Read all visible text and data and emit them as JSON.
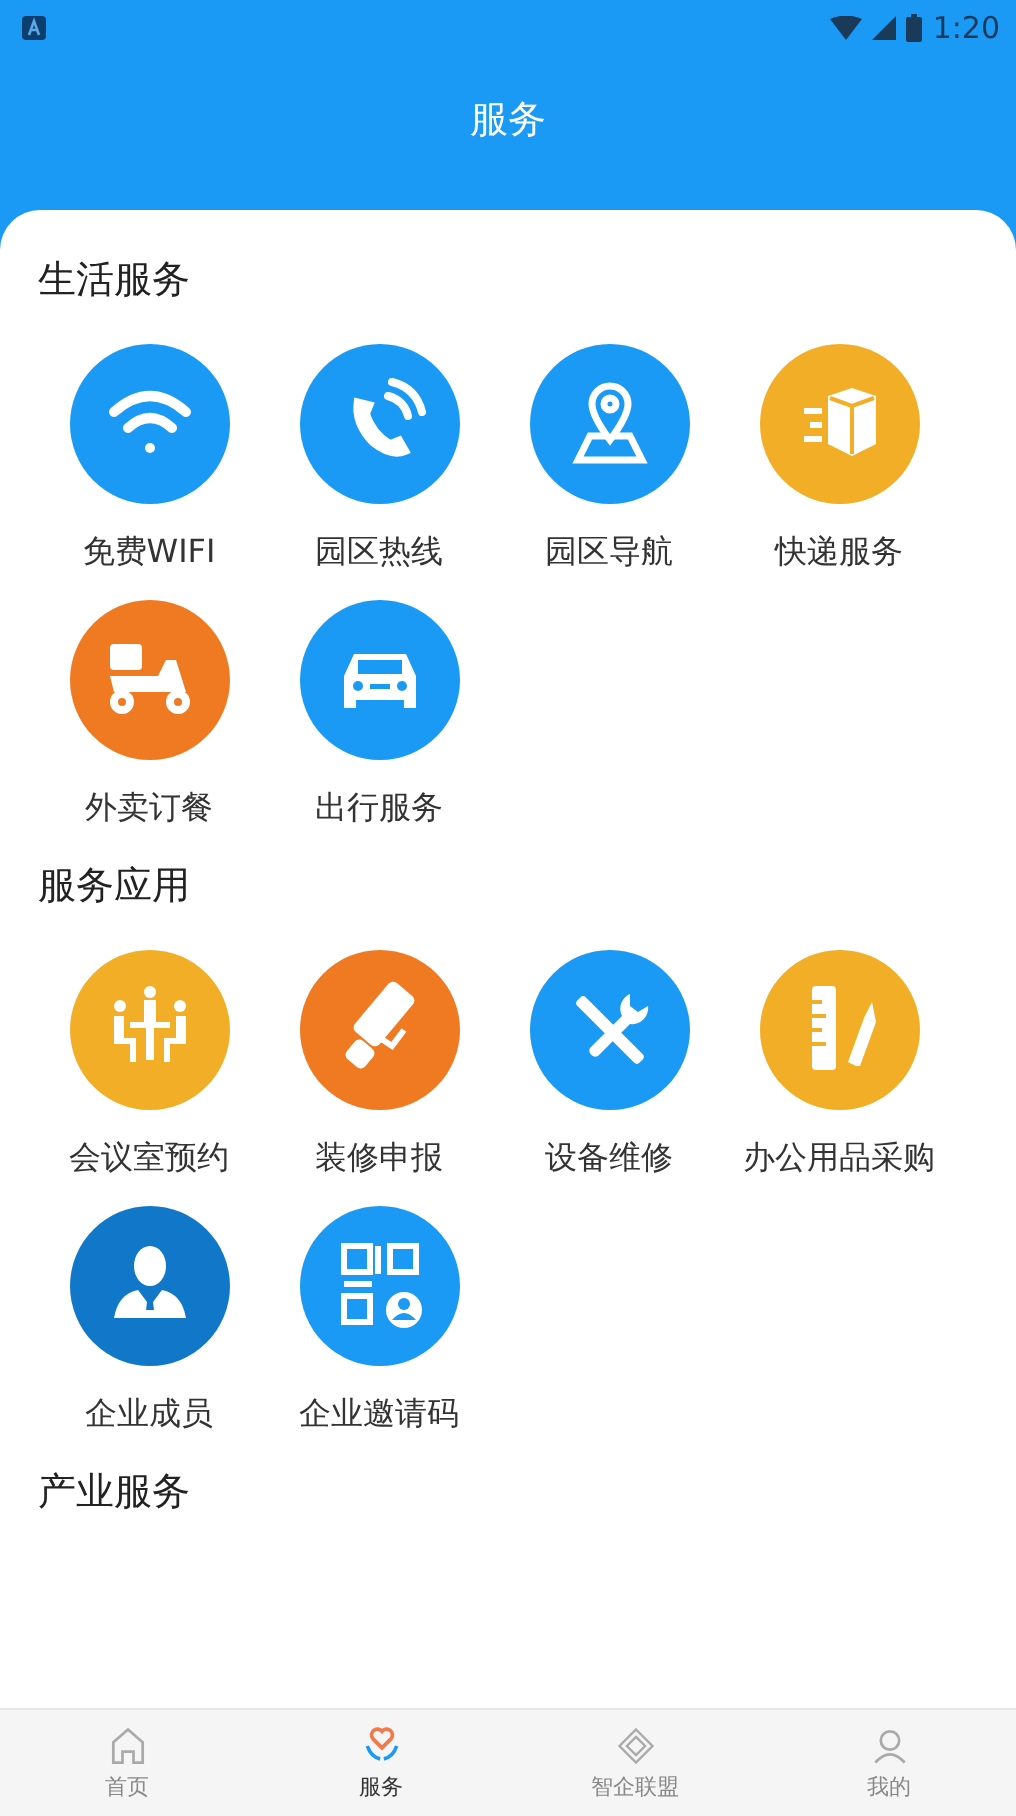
{
  "status_bar": {
    "time": "1:20"
  },
  "header": {
    "title": "服务"
  },
  "sections": [
    {
      "title": "生活服务",
      "items": [
        {
          "label": "免费WIFI",
          "kind": "wifi",
          "color": "#1a9af5"
        },
        {
          "label": "园区热线",
          "kind": "phone",
          "color": "#1a9af5"
        },
        {
          "label": "园区导航",
          "kind": "map",
          "color": "#1a9af5"
        },
        {
          "label": "快递服务",
          "kind": "parcel",
          "color": "#f3ae27"
        },
        {
          "label": "外卖订餐",
          "kind": "scooter",
          "color": "#f07a22"
        },
        {
          "label": "出行服务",
          "kind": "car",
          "color": "#1a9af5"
        }
      ]
    },
    {
      "title": "服务应用",
      "items": [
        {
          "label": "会议室预约",
          "kind": "meeting",
          "color": "#f3ae27"
        },
        {
          "label": "装修申报",
          "kind": "roller",
          "color": "#f07a22"
        },
        {
          "label": "设备维修",
          "kind": "tools",
          "color": "#1a9af5"
        },
        {
          "label": "办公用品采购",
          "kind": "ruler",
          "color": "#f3ae27"
        },
        {
          "label": "企业成员",
          "kind": "person",
          "color": "#1177c9"
        },
        {
          "label": "企业邀请码",
          "kind": "qr",
          "color": "#1a9af5"
        }
      ]
    },
    {
      "title": "产业服务"
    }
  ],
  "tabs": [
    {
      "label": "首页",
      "kind": "home",
      "selected": false
    },
    {
      "label": "服务",
      "kind": "heart",
      "selected": true
    },
    {
      "label": "智企联盟",
      "kind": "diamond",
      "selected": false
    },
    {
      "label": "我的",
      "kind": "user",
      "selected": false
    }
  ]
}
